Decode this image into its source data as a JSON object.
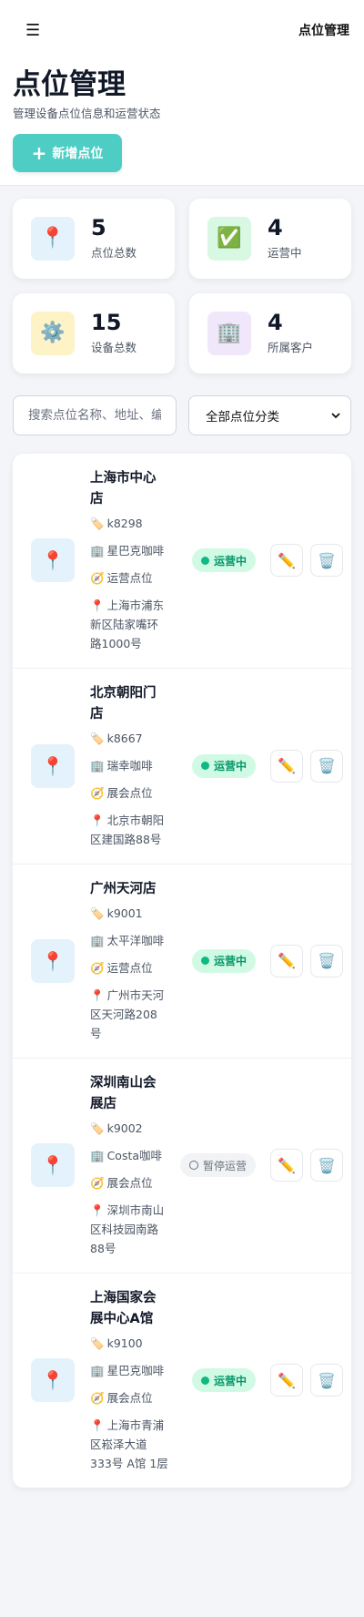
{
  "topbar": {
    "menu_icon": "☰",
    "title": "点位管理"
  },
  "header": {
    "title": "点位管理",
    "subtitle": "管理设备点位信息和运营状态",
    "add_button_label": "新增点位",
    "add_button_color": "#4ecdc4"
  },
  "stats": [
    {
      "icon": "📍",
      "icon_name": "pin-icon",
      "bg": "#e3f2fb",
      "value": "5",
      "label": "点位总数"
    },
    {
      "icon": "✅",
      "icon_name": "check-icon",
      "bg": "#d8f8e4",
      "value": "4",
      "label": "运营中"
    },
    {
      "icon": "⚙️",
      "icon_name": "gear-icon",
      "bg": "#fdf3c7",
      "value": "15",
      "label": "设备总数"
    },
    {
      "icon": "🏢",
      "icon_name": "building-icon",
      "bg": "#f0e7fb",
      "value": "4",
      "label": "所属客户"
    }
  ],
  "filters": {
    "search_placeholder": "搜索点位名称、地址、编号",
    "category_selected": "全部点位分类"
  },
  "icons": {
    "pin": "📍",
    "tag": "🏷️",
    "building": "🏢",
    "compass": "🧭",
    "edit": "✏️",
    "delete": "🗑️"
  },
  "status_colors": {
    "active": "#059669",
    "paused": "#6b7280"
  },
  "sites": [
    {
      "name": "上海市中心店",
      "code": "k8298",
      "customer": "星巴克咖啡",
      "category": "运营点位",
      "address": "上海市浦东新区陆家嘴环路1000号",
      "status": "运营中",
      "status_type": "active"
    },
    {
      "name": "北京朝阳门店",
      "code": "k8667",
      "customer": "瑞幸咖啡",
      "category": "展会点位",
      "address": "北京市朝阳区建国路88号",
      "status": "运营中",
      "status_type": "active"
    },
    {
      "name": "广州天河店",
      "code": "k9001",
      "customer": "太平洋咖啡",
      "category": "运营点位",
      "address": "广州市天河区天河路208号",
      "status": "运营中",
      "status_type": "active"
    },
    {
      "name": "深圳南山会展店",
      "code": "k9002",
      "customer": "Costa咖啡",
      "category": "展会点位",
      "address": "深圳市南山区科技园南路88号",
      "status": "暂停运营",
      "status_type": "paused"
    },
    {
      "name": "上海国家会展中心A馆",
      "code": "k9100",
      "customer": "星巴克咖啡",
      "category": "展会点位",
      "address": "上海市青浦区崧泽大道333号 A馆 1层",
      "status": "运营中",
      "status_type": "active"
    }
  ]
}
